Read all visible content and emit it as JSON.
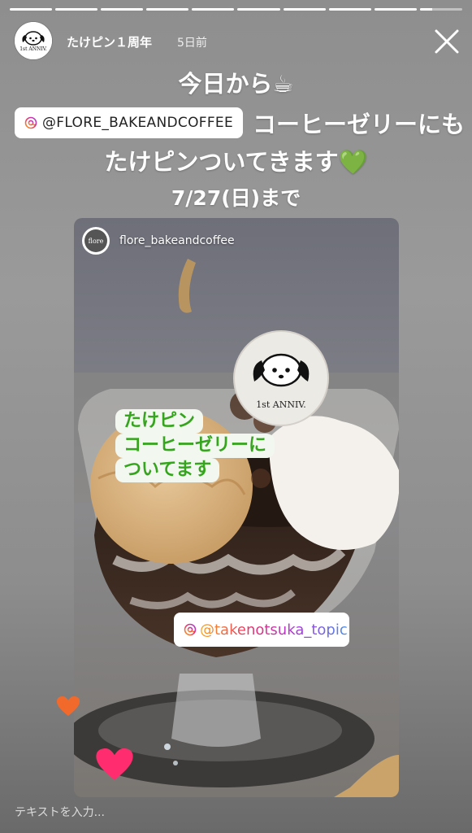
{
  "story": {
    "segments_total": 10,
    "segments_completed": 9,
    "current_segment_progress": 0.3,
    "username": "たけピン１周年",
    "posted_ago": "5日前",
    "avatar_text": "1st ANNIV."
  },
  "headline": {
    "line1": "今日から☕",
    "mention": "@FLORE_BAKEANDCOFFEE",
    "line2_text": "コーヒーゼリーにも",
    "line3": "たけピンついてきます💚",
    "line4": "7/27(日)まで"
  },
  "card": {
    "username": "flore_bakeandcoffee",
    "avatar_text": "flore",
    "sticker_text": "1st ANNIV.",
    "bubble_lines": [
      "たけピン",
      "コーヒーゼリーに",
      "ついてます"
    ],
    "mention_tag": "@takenotsuka_topic"
  },
  "reply": {
    "placeholder": "テキストを入力..."
  },
  "colors": {
    "bubble_text": "#34a51c",
    "heart_orange": "#f26a2b",
    "heart_pink": "#ff2d6f"
  },
  "icons": [
    "close-icon",
    "instagram-at-icon",
    "heart-icon"
  ]
}
